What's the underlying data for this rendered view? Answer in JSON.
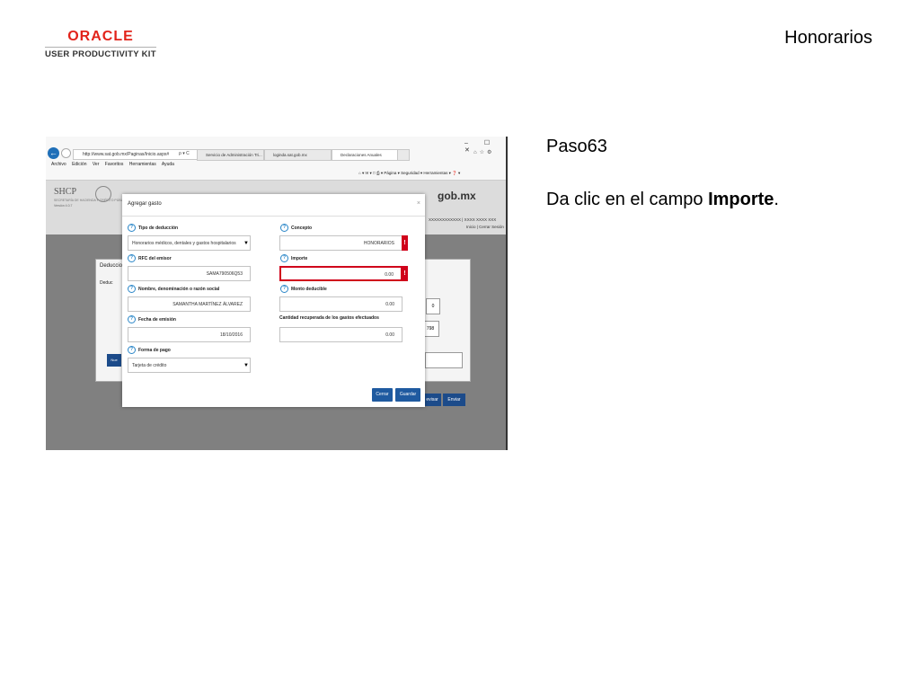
{
  "header": {
    "logo_oracle": "ORACLE",
    "logo_upk": "USER PRODUCTIVITY KIT",
    "slide_title": "Honorarios"
  },
  "instructions": {
    "step": "Paso63",
    "text_prefix": "Da clic en el campo ",
    "text_bold": "Importe",
    "text_suffix": "."
  },
  "browser": {
    "url": "http://www.sat.gob.mx/Paginas/Inicio.aspx#",
    "addr_controls": "ρ ▾ C",
    "tabs": [
      "Servicio de Administración Tri...",
      "loginda.sat.gob.mx",
      "Declaraciones Anuales"
    ],
    "window_controls": "– ☐ ✕",
    "menu": [
      "Archivo",
      "Edición",
      "Ver",
      "Favoritos",
      "Herramientas",
      "Ayuda"
    ],
    "command_bar": "⌂ ▾ ✉ ▾ □ ⎙ ▾ Página ▾ Seguridad ▾ Herramientas ▾ ❓ ▾"
  },
  "site": {
    "shcp": "SHCP",
    "shcp_sub": "SECRETARÍA DE HACIENDA Y CRÉDITO PÚBLICO",
    "version": "Versión 4.0.7",
    "gob": "gob.mx",
    "rfc_bar": "XXXXXXXXXXXX | XXXX XXXX XXX",
    "sesion": "Inicio | Cerrar Sesión",
    "deducciones": "Deduccio",
    "deducciones_sub": "Deduc",
    "bg_value1": "0",
    "bg_value2": "798",
    "bg_btn_revisar": "evisar",
    "bg_btn_enviar": "Enviar",
    "bg_btn_nuevo": "Nue"
  },
  "modal": {
    "title": "Agregar gasto",
    "close": "×",
    "fields": {
      "tipo_label": "Tipo de deducción",
      "tipo_value": "Honorarios médicos, dentales y gastos hospitalarios",
      "concepto_label": "Concepto",
      "concepto_value": "HONORARIOS",
      "rfc_label": "RFC del emisor",
      "rfc_value": "SAMA790506Q53",
      "importe_label": "Importe",
      "importe_value": "0.00",
      "nombre_label": "Nombre, denominación o razón social",
      "nombre_value": "SAMANTHA MARTÍNEZ ÁLVAREZ",
      "monto_label": "Monto deducible",
      "monto_value": "0.00",
      "fecha_label": "Fecha de emisión",
      "fecha_value": "18/10/2016",
      "cantidad_label": "Cantidad recuperada de los gastos efectuados",
      "cantidad_value": "0.00",
      "forma_label": "Forma de pago",
      "forma_value": "Tarjeta de crédito"
    },
    "error_mark": "!",
    "help_mark": "?",
    "cerrar_label": "Cerrar",
    "guardar_label": "Guardar"
  },
  "colors": {
    "oracle_red": "#e2231a",
    "error_red": "#d0021b",
    "button_blue": "#1f5aa0"
  }
}
